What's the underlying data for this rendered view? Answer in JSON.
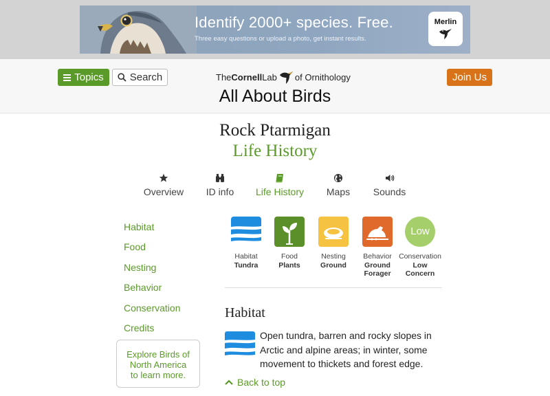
{
  "ad": {
    "headline": "Identify 2000+ species. Free.",
    "subtext": "Three easy questions or upload a photo, get instant results.",
    "badge_label": "Merlin"
  },
  "header": {
    "topics_label": "Topics",
    "search_label": "Search",
    "join_label": "Join Us",
    "logo": {
      "the": "The",
      "cornell": "Cornell",
      "lab": "Lab",
      "of": "of Ornithology"
    },
    "site_title": "All About Birds"
  },
  "page": {
    "species": "Rock Ptarmigan",
    "section": "Life History"
  },
  "tabs": [
    {
      "label": "Overview",
      "icon": "star-icon"
    },
    {
      "label": "ID info",
      "icon": "binoculars-icon"
    },
    {
      "label": "Life History",
      "icon": "book-icon",
      "active": true
    },
    {
      "label": "Maps",
      "icon": "globe-icon"
    },
    {
      "label": "Sounds",
      "icon": "speaker-icon"
    }
  ],
  "sidebar": {
    "links": [
      "Habitat",
      "Food",
      "Nesting",
      "Behavior",
      "Conservation",
      "Credits"
    ],
    "explore": [
      "Explore Birds of",
      "North America",
      "to learn more."
    ]
  },
  "stats": [
    {
      "category": "Habitat",
      "value": "Tundra",
      "icon": "tundra-icon",
      "color": "#1e8de0"
    },
    {
      "category": "Food",
      "value": "Plants",
      "icon": "plant-icon",
      "color": "#5b8f29"
    },
    {
      "category": "Nesting",
      "value": "Ground",
      "icon": "ground-nest-icon",
      "color": "#f5c242"
    },
    {
      "category": "Behavior",
      "value": [
        "Ground",
        "Forager"
      ],
      "icon": "ground-forager-icon",
      "color": "#e06a2b"
    },
    {
      "category": "Conservation",
      "value": [
        "Low",
        "Concern"
      ],
      "icon_text": "Low",
      "color": "#a4cf6a"
    }
  ],
  "habitat": {
    "heading": "Habitat",
    "text": "Open tundra, barren and rocky slopes in Arctic and alpine areas; in winter, some movement to thickets and forest edge.",
    "back_to_top": "Back to top"
  },
  "colors": {
    "accent_green": "#5a9a28",
    "join_orange": "#d9731a"
  }
}
